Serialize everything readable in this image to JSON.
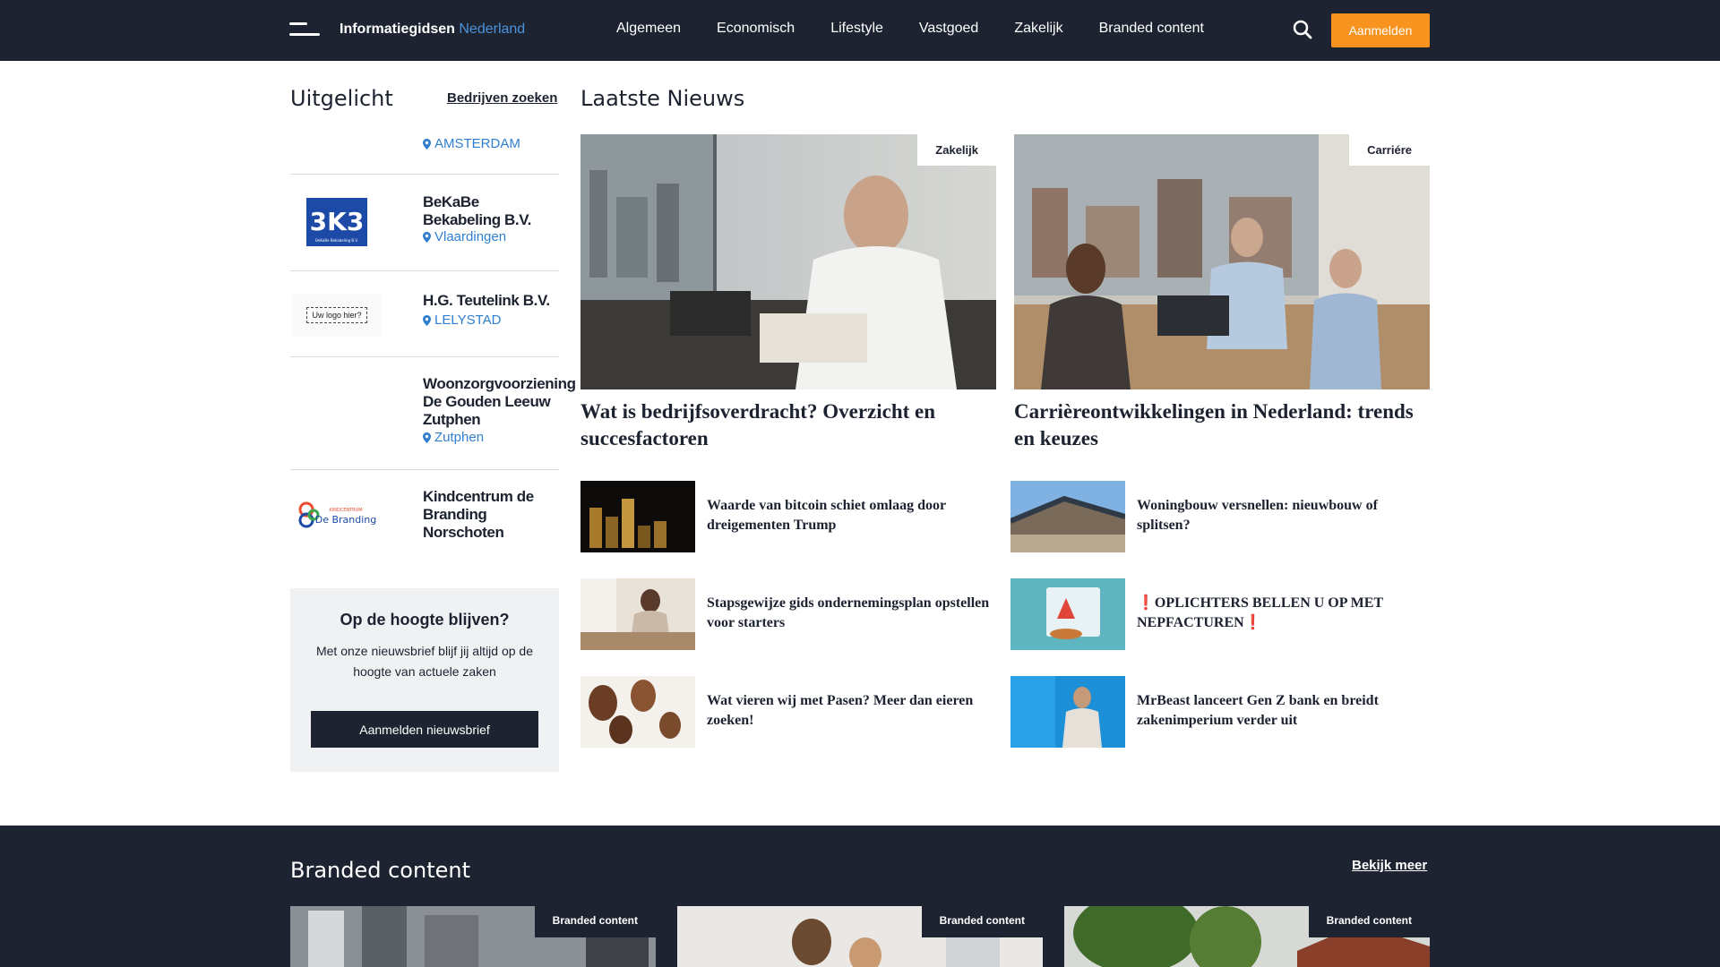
{
  "header": {
    "brand_main": "Informatiegidsen",
    "brand_accent": "Nederland",
    "nav": [
      "Algemeen",
      "Economisch",
      "Lifestyle",
      "Vastgoed",
      "Zakelijk",
      "Branded content"
    ],
    "signup_label": "Aanmelden",
    "accent_color": "#f7931e",
    "bar_color": "#1d2330"
  },
  "sidebar": {
    "title": "Uitgelicht",
    "search_link": "Bedrijven zoeken",
    "companies": [
      {
        "name": "",
        "city": "AMSTERDAM",
        "logo": ""
      },
      {
        "name": "BeKaBe Bekabeling B.V.",
        "city": "Vlaardingen",
        "logo": "3K3",
        "logo_sub": "BeKaBe Bekabeling B.V."
      },
      {
        "name": "H.G. Teutelink B.V.",
        "city": "LELYSTAD",
        "logo": "Uw logo hier?"
      },
      {
        "name": "Woonzorgvoorziening De Gouden Leeuw Zutphen",
        "city": "Zutphen",
        "logo": ""
      },
      {
        "name": "Kindcentrum de Branding Norschoten",
        "city": "",
        "logo": "De Branding",
        "logo_top": "KINDCENTRUM"
      }
    ],
    "newsletter": {
      "title": "Op de hoogte blijven?",
      "text": "Met onze nieuwsbrief blijf jij altijd op de hoogte van actuele zaken",
      "button": "Aanmelden nieuwsbrief"
    }
  },
  "news": {
    "title": "Laatste Nieuws",
    "featured": [
      {
        "tag": "Zakelijk",
        "title": "Wat is bedrijfsoverdracht? Overzicht en succesfactoren"
      },
      {
        "tag": "Carriére",
        "title": "Carrièreontwikkelingen in Nederland: trends en keuzes"
      }
    ],
    "items": [
      {
        "title": "Waarde van bitcoin schiet omlaag door dreigementen Trump"
      },
      {
        "title": "Woningbouw versnellen: nieuwbouw of splitsen?"
      },
      {
        "title": "Stapsgewijze gids ondernemingsplan opstellen voor starters"
      },
      {
        "title": "❗OPLICHTERS BELLEN U OP MET NEPFACTUREN❗"
      },
      {
        "title": "Wat vieren wij met Pasen? Meer dan eieren zoeken!"
      },
      {
        "title": "MrBeast lanceert Gen Z bank en breidt zakenimperium verder uit"
      }
    ]
  },
  "branded": {
    "title": "Branded content",
    "more": "Bekijk meer",
    "cards": [
      {
        "tag": "Branded content"
      },
      {
        "tag": "Branded content"
      },
      {
        "tag": "Branded content"
      }
    ]
  }
}
